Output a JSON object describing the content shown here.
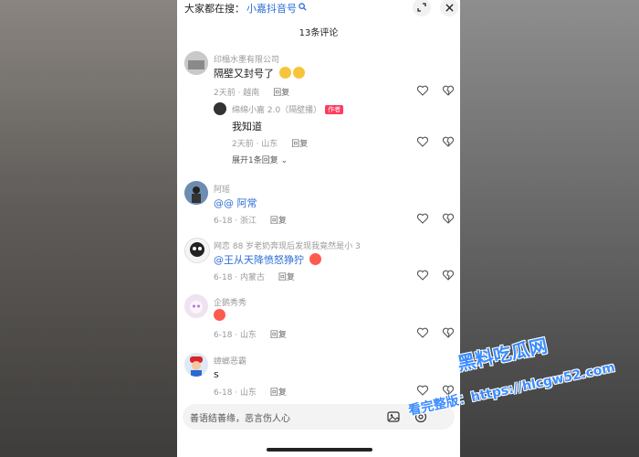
{
  "search": {
    "prefix": "大家都在搜：",
    "keyword": "小嘉抖音号"
  },
  "header": {
    "count": "13条评论"
  },
  "comments": [
    {
      "name": "印榻水墨有限公司",
      "text": "隔壁又封号了",
      "emojis": [
        "laughing-crying-emoji",
        "laughing-crying-emoji"
      ],
      "time": "2天前 · 越南",
      "reply": "回复"
    },
    {
      "name": "阿瑶",
      "text": "@@ 阿常",
      "time": "6-18 · 浙江",
      "reply": "回复"
    },
    {
      "name": "网恋 88 岁老奶奔现后发现我竟然是小 3",
      "text": "@王从天降愤怒狰狞",
      "emojis": [
        "heart-eyes-emoji"
      ],
      "time": "6-18 · 内蒙古",
      "reply": "回复"
    },
    {
      "name": "企鹅秀秀",
      "text": "",
      "emojis": [
        "heart-eyes-emoji"
      ],
      "time": "6-18 · 山东",
      "reply": "回复"
    },
    {
      "name": "蟑螂恶霸",
      "text": "s",
      "time": "6-18 · 山东",
      "reply": "回复"
    }
  ],
  "subreply": {
    "name": "绵绵小嘉 2.0（隔壁播）",
    "author_tag": "作者",
    "text": "我知道",
    "time": "2天前 · 山东",
    "reply": "回复",
    "expand": "展开1条回复"
  },
  "input": {
    "placeholder": "善语结善缘，恶言伤人心"
  },
  "watermark": {
    "big": "黑料吃瓜网",
    "small": "看完整版：https://hlcgw52.com"
  },
  "colors": {
    "mention": "#2f6fd6",
    "author_tag": "#ff3b5c",
    "watermark": "#3b8cff"
  }
}
